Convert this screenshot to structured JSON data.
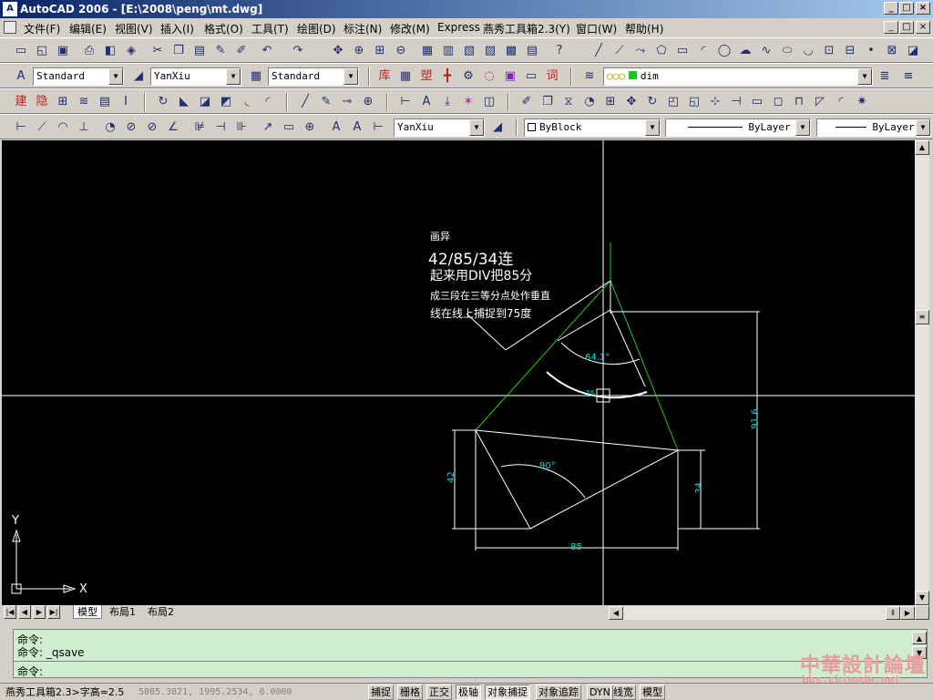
{
  "window": {
    "title": "AutoCAD 2006 - [E:\\2008\\peng\\mt.dwg]",
    "app_icon": "autocad-app-icon",
    "min": "_",
    "max": "□",
    "close": "×"
  },
  "menu": {
    "items": [
      "文件(F)",
      "编辑(E)",
      "视图(V)",
      "插入(I)",
      "格式(O)",
      "工具(T)",
      "绘图(D)",
      "标注(N)",
      "修改(M)",
      "Express",
      "燕秀工具箱2.3(Y)",
      "窗口(W)",
      "帮助(H)"
    ],
    "doc_min": "_",
    "doc_max": "□",
    "doc_close": "×"
  },
  "toolbars": {
    "text_style": "Standard",
    "dim_style": "YanXiu",
    "table_style": "Standard",
    "layer": "dim",
    "dim_style_2": "YanXiu",
    "color": "ByBlock",
    "linetype": "ByLayer",
    "lineweight": "ByLayer"
  },
  "drawing": {
    "note": {
      "line1": "画异",
      "line2": "42/85/34连",
      "line3": "起来用DIV把85分",
      "line4": "成三段在三等分点处作垂直",
      "line5": "线在线上捕捉到75度"
    },
    "dims": {
      "d42": "42",
      "d85": "85",
      "d34": "34",
      "d91": "91.6",
      "a90": "90°",
      "a64": "64.1°",
      "a75": "75"
    },
    "ucs_x": "X",
    "ucs_y": "Y"
  },
  "layout_tabs": {
    "model": "模型",
    "layout1": "布局1",
    "layout2": "布局2"
  },
  "command": {
    "line1": "命令:",
    "line2": "命令: _qsave",
    "line3": "命令:"
  },
  "status": {
    "left": "燕秀工具箱2.3>字高=2.5",
    "coords": "5085.3821,  1995.2534,  0.0000",
    "toggles": [
      "捕捉",
      "栅格",
      "正交",
      "极轴",
      "对象捕捉",
      "对象追踪",
      "DYN",
      "线宽",
      "模型"
    ]
  },
  "watermark": {
    "cn": "中華設計論壇",
    "url": "bbs.chinade.net"
  },
  "colors": {
    "canvas": "#000000",
    "geometry": "#ffffff",
    "construction": "#22cc22",
    "dimension": "#00e0e0",
    "command_bg": "#cfeecf"
  }
}
